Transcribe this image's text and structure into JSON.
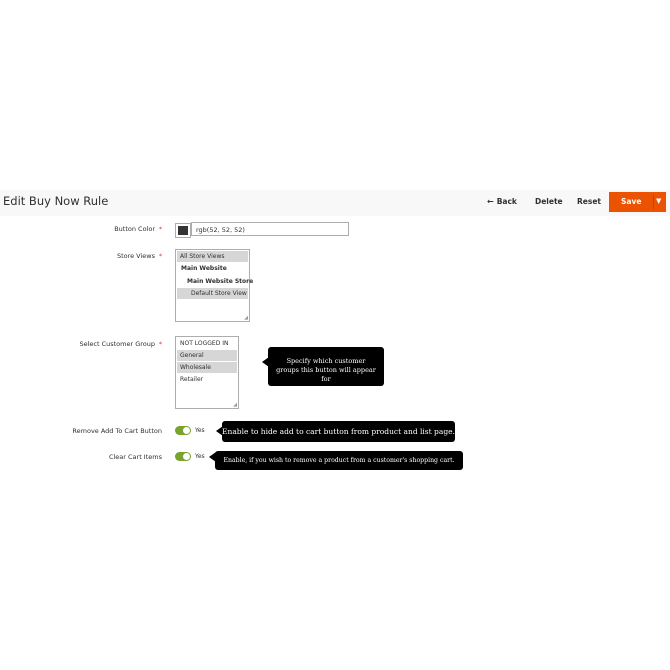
{
  "header": {
    "title": "Edit Buy Now Rule",
    "back_label": "Back",
    "back_icon": "←",
    "delete_label": "Delete",
    "reset_label": "Reset",
    "save_label": "Save",
    "save_caret": "▼",
    "save_color": "#eb5202"
  },
  "form": {
    "button_color": {
      "label": "Button Color",
      "required": "*",
      "value": "rgb(52, 52, 52)",
      "swatch_color": "#343434"
    },
    "store_views": {
      "label": "Store Views",
      "required": "*",
      "options": [
        {
          "label": "All Store Views",
          "selected": true
        },
        {
          "label": "Main Website",
          "selected": false
        },
        {
          "label": "Main Website Store",
          "selected": false
        },
        {
          "label": "Default Store View",
          "selected": true
        }
      ]
    },
    "customer_group": {
      "label": "Select Customer Group",
      "required": "*",
      "options": [
        {
          "label": "NOT LOGGED IN",
          "selected": false
        },
        {
          "label": "General",
          "selected": true
        },
        {
          "label": "Wholesale",
          "selected": true
        },
        {
          "label": "Retailer",
          "selected": false
        }
      ],
      "tooltip": "Specify which customer groups this button will appear for"
    },
    "remove_add_to_cart": {
      "label": "Remove Add To Cart Button",
      "value": "Yes",
      "enabled": true,
      "tooltip": "Enable to hide add to cart button from product and list page."
    },
    "clear_cart": {
      "label": "Clear Cart Items",
      "value": "Yes",
      "enabled": true,
      "tooltip": "Enable, if you wish to remove a product from a customer's shopping cart."
    }
  }
}
